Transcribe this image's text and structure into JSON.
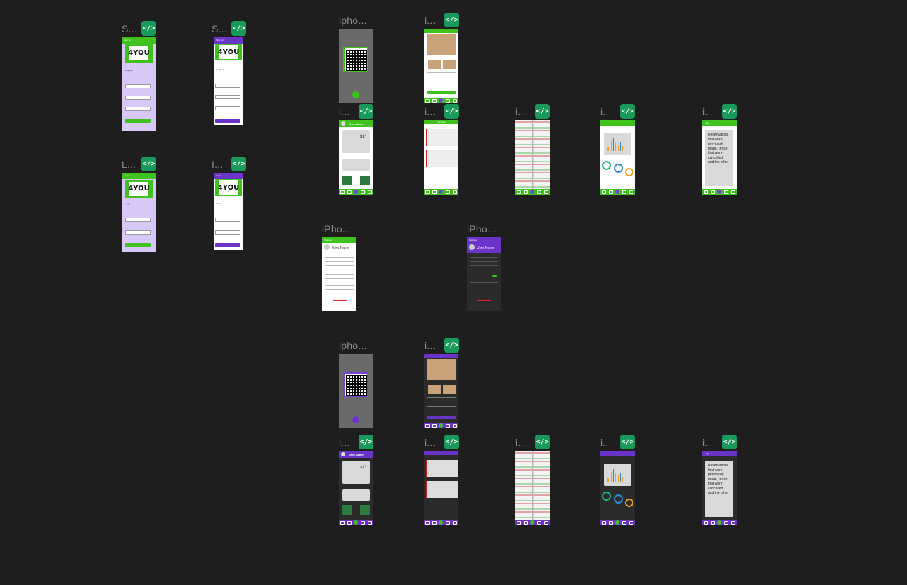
{
  "canvas": {
    "background": "#1e1e1e"
  },
  "colors": {
    "green": "#3fc21b",
    "purple": "#6b34c9",
    "badge": "#199a5b"
  },
  "code_icon_text": "</>",
  "frames": [
    {
      "id": "signup-green",
      "label": "S..."
    },
    {
      "id": "signup-purple",
      "label": "S..."
    },
    {
      "id": "login-green",
      "label": "L..."
    },
    {
      "id": "login-purple",
      "label": "I..."
    },
    {
      "id": "qr-green",
      "label": "ipho..."
    },
    {
      "id": "detail-green",
      "label": "i..."
    },
    {
      "id": "home-green",
      "label": "i..."
    },
    {
      "id": "reserve-green",
      "label": "i..."
    },
    {
      "id": "map-green",
      "label": "i..."
    },
    {
      "id": "stats-green",
      "label": "i..."
    },
    {
      "id": "log-green",
      "label": "i..."
    },
    {
      "id": "settings-green",
      "label": "iPho..."
    },
    {
      "id": "settings-purple",
      "label": "iPho..."
    },
    {
      "id": "qr-purple",
      "label": "ipho..."
    },
    {
      "id": "detail-purple",
      "label": "i..."
    },
    {
      "id": "home-purple",
      "label": "i..."
    },
    {
      "id": "reserve-purple",
      "label": "i..."
    },
    {
      "id": "map-purple",
      "label": "i..."
    },
    {
      "id": "stats-purple",
      "label": "i..."
    },
    {
      "id": "log-purple",
      "label": "i..."
    }
  ],
  "screens": {
    "signup": {
      "bar": "Sign Up",
      "heading": "Register",
      "button": "Register",
      "logo": "4YOU"
    },
    "login": {
      "bar": "Login",
      "heading": "Login",
      "button": "Login",
      "logo": "4YOU"
    },
    "home": {
      "username": "User.Name",
      "temp": "32°"
    },
    "reserve": {
      "bar": "Reserve"
    },
    "log": {
      "bar": "Log",
      "text": "Reservations that were previously made, those that were cancelled, and the other"
    },
    "settings": {
      "bar": "Settings",
      "username": "User.Name"
    }
  }
}
